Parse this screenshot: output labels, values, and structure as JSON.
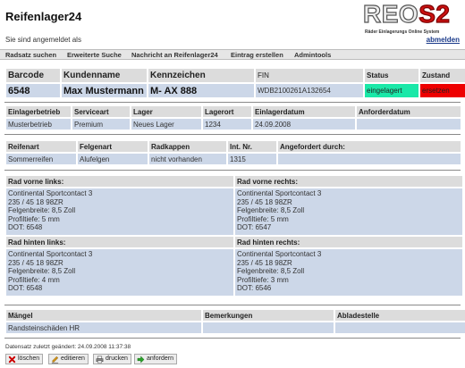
{
  "header": {
    "app_title": "Reifenlager24",
    "logo_black": "REO",
    "logo_red": "S2",
    "logo_tagline": "Räder Einlagerungs Online System",
    "login_status": "Sie sind angemeldet als",
    "logout_label": "abmelden"
  },
  "nav": {
    "items": [
      "Radsatz suchen",
      "Erweiterte Suche",
      "Nachricht an Reifenlager24",
      "Eintrag erstellen",
      "Admintools"
    ]
  },
  "summary": {
    "headers": {
      "barcode": "Barcode",
      "customer": "Kundenname",
      "plate": "Kennzeichen",
      "fin": "FIN",
      "status": "Status",
      "state": "Zustand"
    },
    "values": {
      "barcode": "6548",
      "customer": "Max Mustermann",
      "plate": "M- AX 888",
      "fin": "WDB2100261A132654",
      "status": "eingelagert",
      "state": "ersetzen"
    }
  },
  "storage": {
    "headers": [
      "Einlagerbetrieb",
      "Serviceart",
      "Lager",
      "Lagerort",
      "Einlagerdatum",
      "Anforderdatum"
    ],
    "values": [
      "Musterbetrieb",
      "Premium",
      "Neues Lager",
      "1234",
      "24.09.2008",
      ""
    ]
  },
  "tires": {
    "headers": [
      "Reifenart",
      "Felgenart",
      "Radkappen",
      "Int. Nr.",
      "Angefordert durch:"
    ],
    "values": [
      "Sommerreifen",
      "Alufelgen",
      "nicht vorhanden",
      "1315",
      ""
    ]
  },
  "wheels": {
    "front_left": {
      "title": "Rad vorne links:",
      "lines": [
        "Continental Sportcontact 3",
        "235 / 45 18  98ZR",
        "Felgenbreite: 8,5 Zoll",
        "Profiltiefe: 5 mm",
        "DOT: 6548"
      ]
    },
    "front_right": {
      "title": "Rad vorne rechts:",
      "lines": [
        "Continental Sportcontact 3",
        "235 / 45 18  98ZR",
        "Felgenbreite: 8,5 Zoll",
        "Profiltiefe: 5 mm",
        "DOT: 6547"
      ]
    },
    "rear_left": {
      "title": "Rad hinten links:",
      "lines": [
        "Continental Sportcontact 3",
        "235 / 45 18  98ZR",
        "Felgenbreite: 8,5 Zoll",
        "Profiltiefe: 4 mm",
        "DOT: 6548"
      ]
    },
    "rear_right": {
      "title": "Rad hinten rechts:",
      "lines": [
        "Continental Sportcontact 3",
        "235 / 45 18  98ZR",
        "Felgenbreite: 8,5 Zoll",
        "Profiltiefe: 3 mm",
        "DOT: 6546"
      ]
    }
  },
  "defects": {
    "headers": [
      "Mängel",
      "Bemerkungen",
      "Abladestelle"
    ],
    "values": [
      "Randsteinschäden HR",
      "",
      ""
    ]
  },
  "footer": {
    "last_changed": "Datensatz zuletzt geändert: 24.09.2008 11:37:38",
    "buttons": {
      "delete": "löschen",
      "edit": "editieren",
      "print": "drucken",
      "request": "anfordern"
    }
  },
  "colors": {
    "status_stored": "#1ae8a8",
    "state_replace": "#ee0000",
    "cell_bg": "#ccd7e8",
    "header_bg": "#dcdcdc",
    "logo_red": "#cc1111"
  }
}
